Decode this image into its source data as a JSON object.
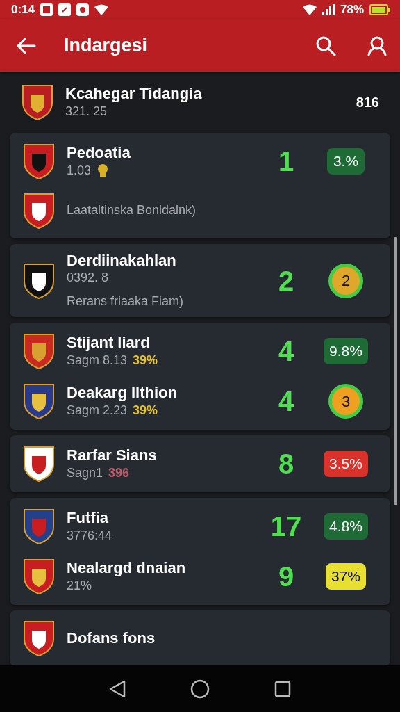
{
  "status_bar": {
    "time": "0:14",
    "battery": "78%"
  },
  "app_bar": {
    "title": "Indargesi"
  },
  "header": {
    "name": "Kcahegar Tidangia",
    "sub": "321. 25",
    "value": "816"
  },
  "cards": [
    {
      "rows": [
        {
          "name": "Pedoatia",
          "sub": "1.03",
          "sub_icon": true,
          "value": "1",
          "badge": {
            "kind": "pill",
            "text": "3.%",
            "color": "#1e6b35"
          }
        },
        {
          "note": "Laataltinska Bonldalnk)"
        }
      ]
    },
    {
      "rows": [
        {
          "name": "Derdiinakahlan",
          "sub": "0392. 8",
          "sub_icon": false,
          "note": "Rerans friaaka Fiam)",
          "value": "2",
          "badge": {
            "kind": "ring",
            "text": "2",
            "color": "#e0a82a"
          }
        }
      ]
    },
    {
      "rows": [
        {
          "name": "Stijant liard",
          "sub": "Sagm 8.13",
          "accent": {
            "text": "39%",
            "color": "#e6c02a"
          },
          "sub_icon": false,
          "value": "4",
          "badge": {
            "kind": "pill",
            "text": "9.8%",
            "color": "#1e6b35"
          }
        },
        {
          "name": "Deakarg Ilthion",
          "sub": "Sagm 2.23",
          "accent": {
            "text": "39%",
            "color": "#e6c02a"
          },
          "sub_icon": false,
          "value": "4",
          "badge": {
            "kind": "ring",
            "text": "3",
            "color": "#f0a020"
          }
        }
      ]
    },
    {
      "rows": [
        {
          "name": "Rarfar Sians",
          "sub": "Sagn1",
          "accent": {
            "text": "396",
            "color": "#c25a6a"
          },
          "sub_icon": false,
          "value": "8",
          "badge": {
            "kind": "pill",
            "text": "3.5%",
            "color": "#d8322a"
          }
        }
      ]
    },
    {
      "rows": [
        {
          "name": "Futfia",
          "sub": "3776:44",
          "sub_icon": false,
          "value": "17",
          "badge": {
            "kind": "pill",
            "text": "4.8%",
            "color": "#1e6b35"
          }
        },
        {
          "name": "Nealargd dnaian",
          "sub": "21%",
          "sub_icon": false,
          "value": "9",
          "badge": {
            "kind": "pill",
            "text": "37%",
            "color": "#e8e030"
          }
        }
      ]
    },
    {
      "rows": [
        {
          "name": "Dofans fons"
        }
      ]
    }
  ]
}
